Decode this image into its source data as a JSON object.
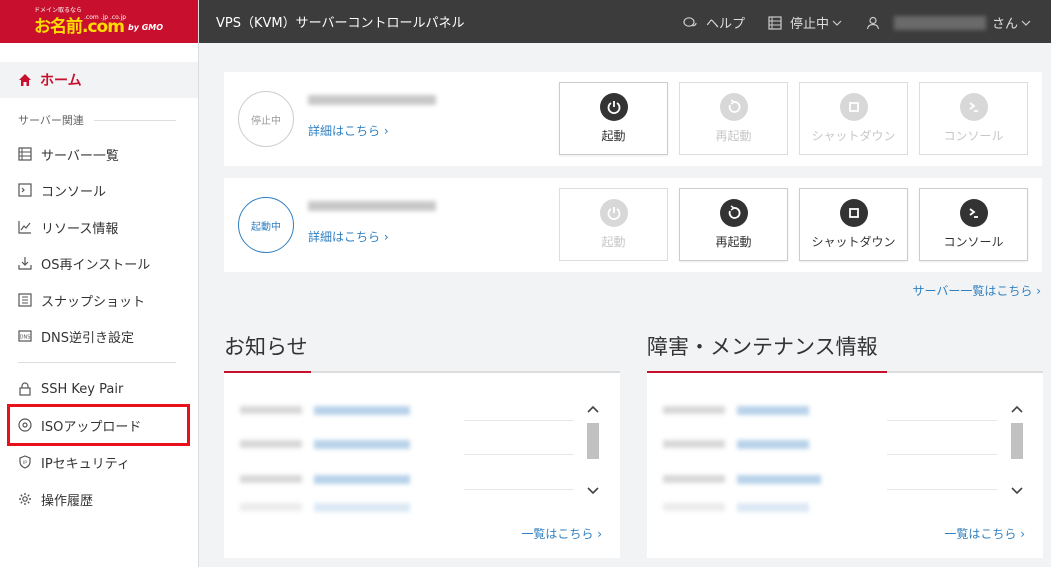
{
  "logo": {
    "tagline": "ドメイン取るなら",
    "brand": "お名前.com",
    "domains": ".com .jp .co.jp",
    "company": "by GMO"
  },
  "header": {
    "title": "VPS（KVM）サーバーコントロールパネル",
    "help": "ヘルプ",
    "status_filter": "停止中",
    "user_suffix": "さん"
  },
  "sidebar": {
    "home": "ホーム",
    "section": "サーバー関連",
    "items": [
      {
        "label": "サーバー一覧",
        "icon": "server-list-icon"
      },
      {
        "label": "コンソール",
        "icon": "console-icon"
      },
      {
        "label": "リソース情報",
        "icon": "chart-icon"
      },
      {
        "label": "OS再インストール",
        "icon": "download-icon"
      },
      {
        "label": "スナップショット",
        "icon": "snapshot-icon"
      },
      {
        "label": "DNS逆引き設定",
        "icon": "dns-icon"
      }
    ],
    "items2": [
      {
        "label": "SSH Key Pair",
        "icon": "lock-icon"
      },
      {
        "label": "ISOアップロード",
        "icon": "disc-icon"
      },
      {
        "label": "IPセキュリティ",
        "icon": "shield-icon"
      },
      {
        "label": "操作履歴",
        "icon": "gear-icon"
      }
    ]
  },
  "servers": [
    {
      "status": "停止中",
      "detail": "詳細はこちら ›"
    },
    {
      "status": "起動中",
      "detail": "詳細はこちら ›"
    }
  ],
  "actions": {
    "start": "起動",
    "restart": "再起動",
    "shutdown": "シャットダウン",
    "console": "コンソール"
  },
  "server_list_link": "サーバー一覧はこちら ›",
  "news": {
    "title": "お知らせ",
    "more": "一覧はこちら ›"
  },
  "maintenance": {
    "title": "障害・メンテナンス情報",
    "more": "一覧はこちら ›"
  },
  "colors": {
    "brand": "#c8102e",
    "header": "#3c3c3c",
    "link": "#2f7fc1",
    "highlight": "#e8101a"
  }
}
